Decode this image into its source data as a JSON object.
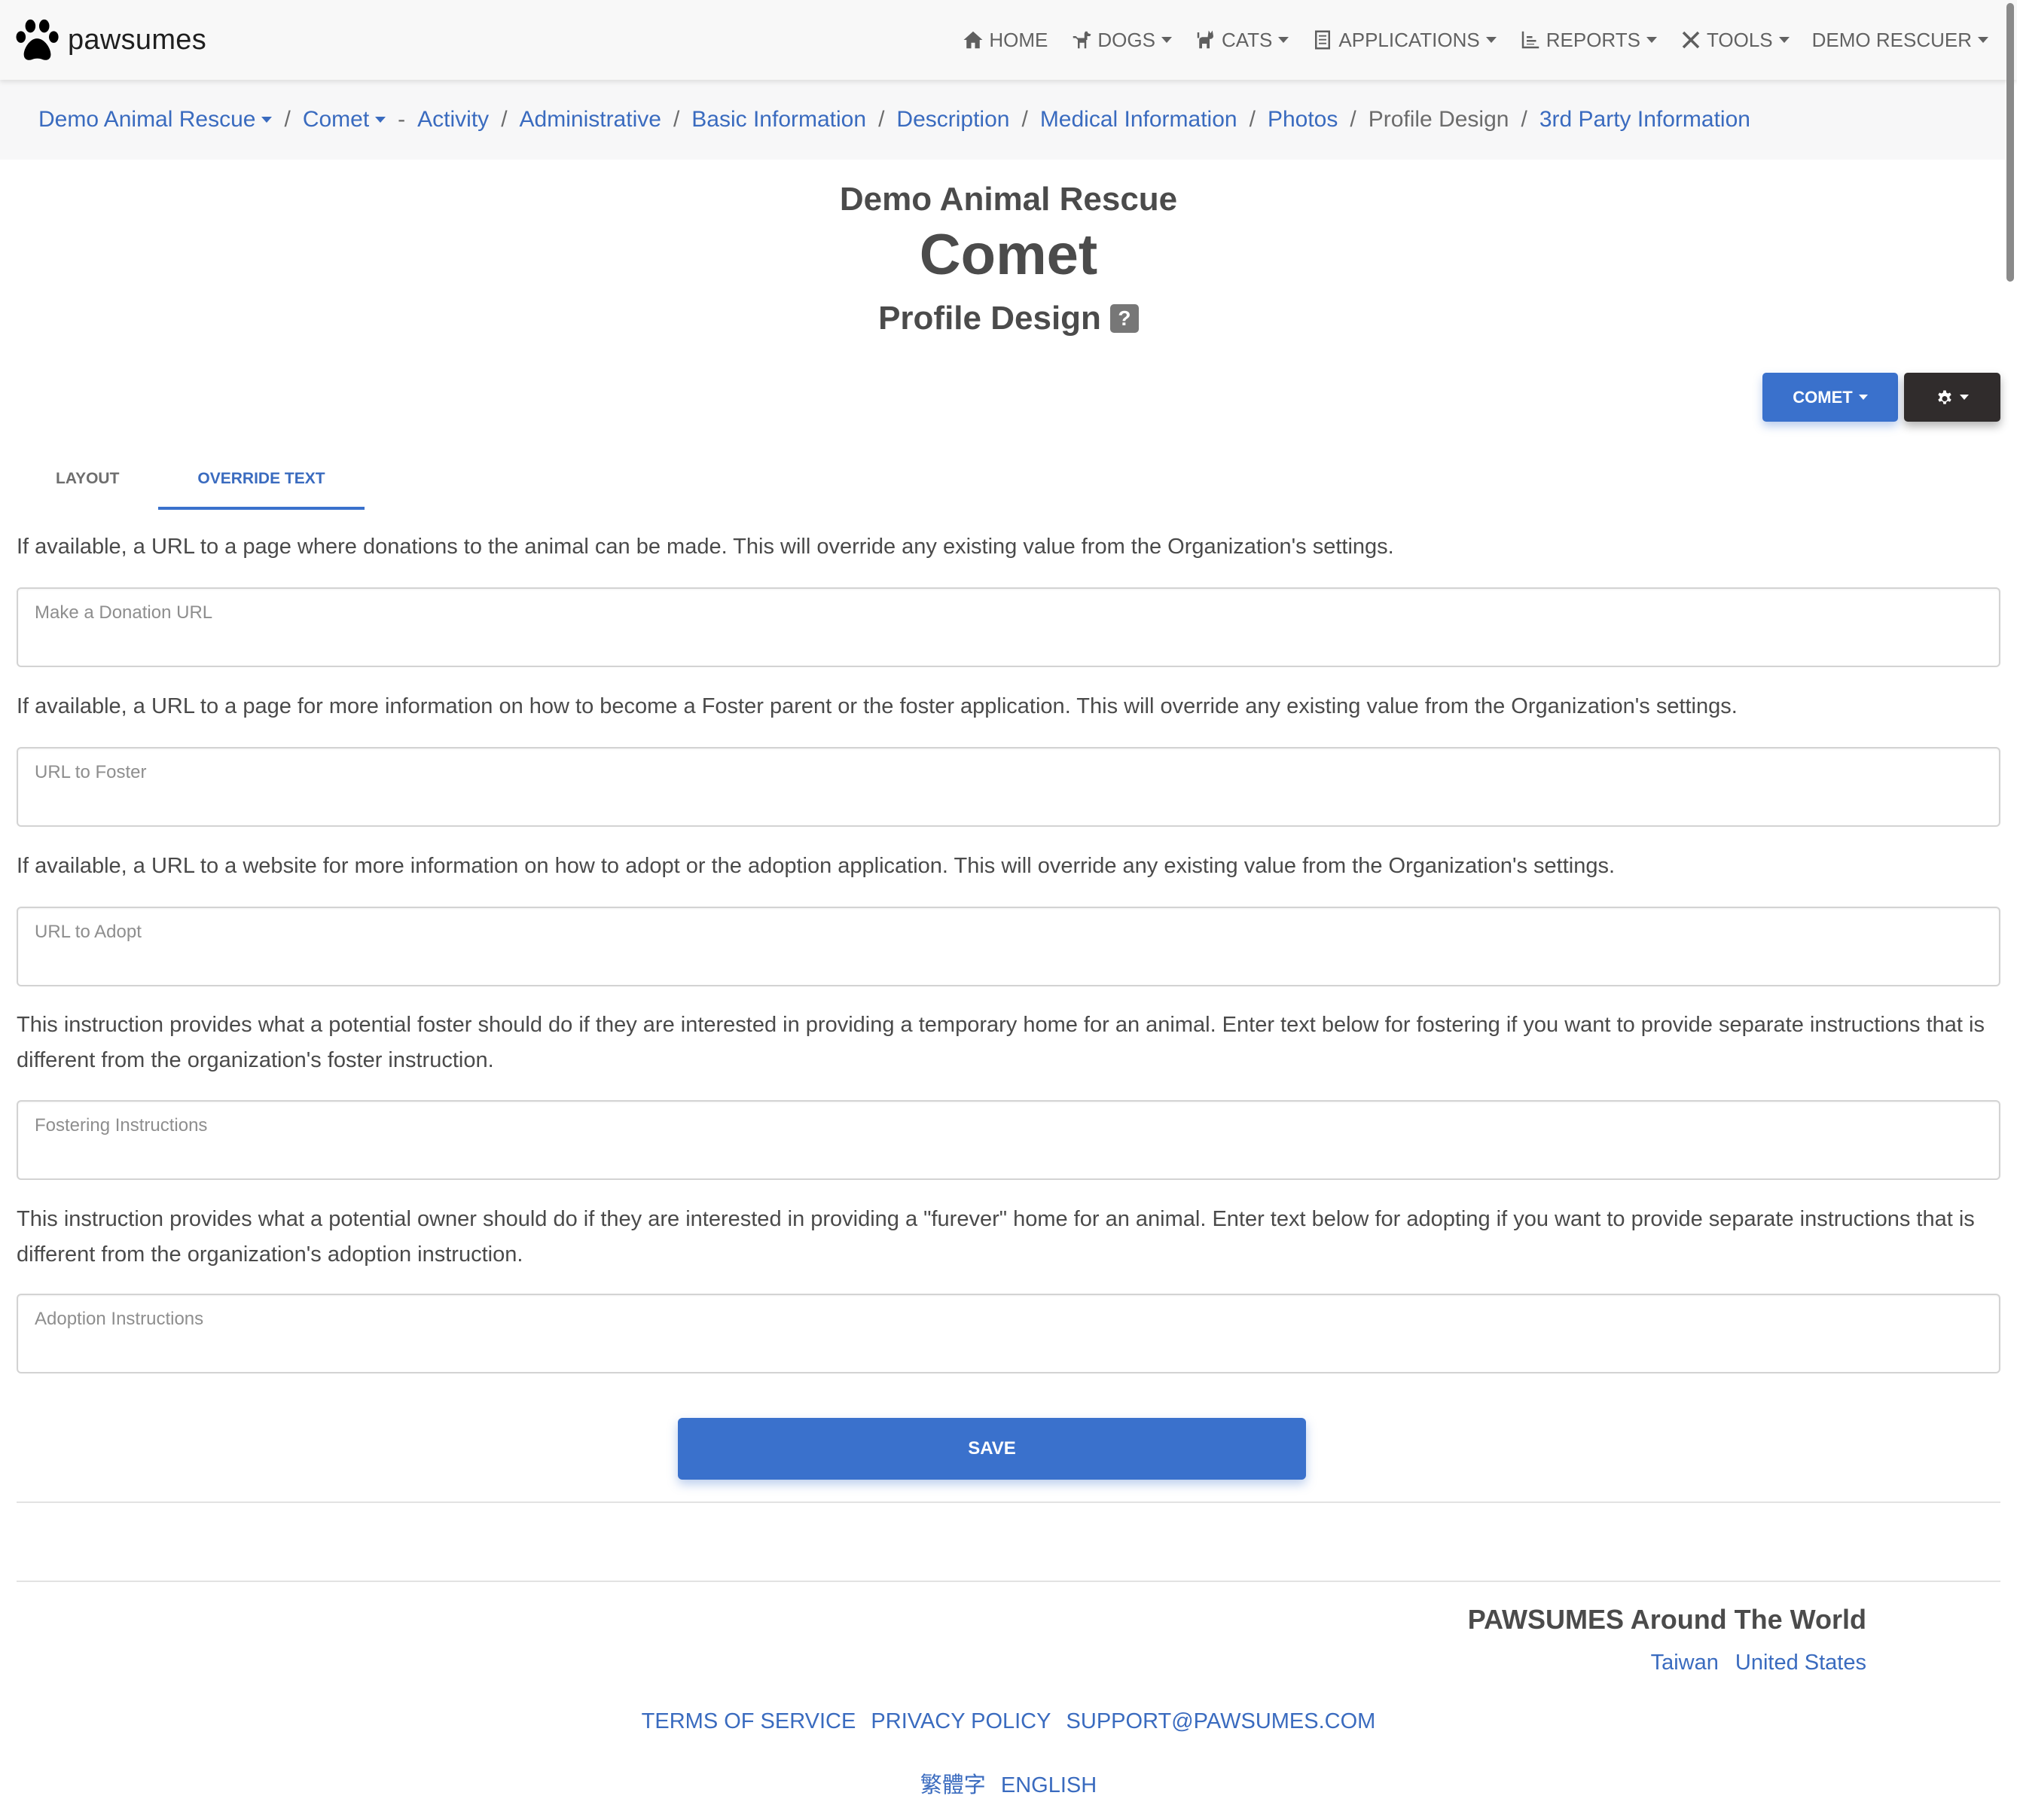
{
  "navbar": {
    "brand": "pawsumes",
    "items": [
      {
        "label": "HOME",
        "icon": "home-icon",
        "dropdown": false
      },
      {
        "label": "DOGS",
        "icon": "dog-icon",
        "dropdown": true
      },
      {
        "label": "CATS",
        "icon": "cat-icon",
        "dropdown": true
      },
      {
        "label": "APPLICATIONS",
        "icon": "clipboard-icon",
        "dropdown": true
      },
      {
        "label": "REPORTS",
        "icon": "chart-icon",
        "dropdown": true
      },
      {
        "label": "TOOLS",
        "icon": "tools-icon",
        "dropdown": true
      },
      {
        "label": "DEMO RESCUER",
        "icon": "",
        "dropdown": true
      }
    ]
  },
  "breadcrumb": {
    "org": "Demo Animal Rescue",
    "animal": "Comet",
    "dash": "-",
    "sep": "/",
    "items": [
      {
        "label": "Activity",
        "active": false
      },
      {
        "label": "Administrative",
        "active": false
      },
      {
        "label": "Basic Information",
        "active": false
      },
      {
        "label": "Description",
        "active": false
      },
      {
        "label": "Medical Information",
        "active": false
      },
      {
        "label": "Photos",
        "active": false
      },
      {
        "label": "Profile Design",
        "active": true
      },
      {
        "label": "3rd Party Information",
        "active": false
      }
    ]
  },
  "header": {
    "org_title": "Demo Animal Rescue",
    "animal_title": "Comet",
    "page_title": "Profile Design",
    "help_icon": "?"
  },
  "actions": {
    "animal_button": "COMET",
    "settings_icon": "gear-icon"
  },
  "tabs": [
    {
      "label": "LAYOUT",
      "active": false
    },
    {
      "label": "OVERRIDE TEXT",
      "active": true
    }
  ],
  "form": {
    "fields": [
      {
        "description": "If available, a URL to a page where donations to the animal can be made. This will override any existing value from the Organization's settings.",
        "placeholder": "Make a Donation URL",
        "value": ""
      },
      {
        "description": "If available, a URL to a page for more information on how to become a Foster parent or the foster application. This will override any existing value from the Organization's settings.",
        "placeholder": "URL to Foster",
        "value": ""
      },
      {
        "description": "If available, a URL to a website for more information on how to adopt or the adoption application. This will override any existing value from the Organization's settings.",
        "placeholder": "URL to Adopt",
        "value": ""
      },
      {
        "description": "This instruction provides what a potential foster should do if they are interested in providing a temporary home for an animal. Enter text below for fostering if you want to provide separate instructions that is different from the organization's foster instruction.",
        "placeholder": "Fostering Instructions",
        "value": ""
      },
      {
        "description": "This instruction provides what a potential owner should do if they are interested in providing a \"furever\" home for an animal. Enter text below for adopting if you want to provide separate instructions that is different from the organization's adoption instruction.",
        "placeholder": "Adoption Instructions",
        "value": ""
      }
    ],
    "save_label": "SAVE"
  },
  "footer": {
    "world_title": "PAWSUMES Around The World",
    "countries": [
      "Taiwan",
      "United States"
    ],
    "legal_links": [
      "TERMS OF SERVICE",
      "PRIVACY POLICY",
      "SUPPORT@PAWSUMES.COM"
    ],
    "languages": [
      "繁體字",
      "ENGLISH"
    ]
  },
  "colors": {
    "accent": "#3a71cc",
    "link": "#3a6bbf",
    "dark_button": "#302c2c",
    "text": "#4a4a4a"
  }
}
